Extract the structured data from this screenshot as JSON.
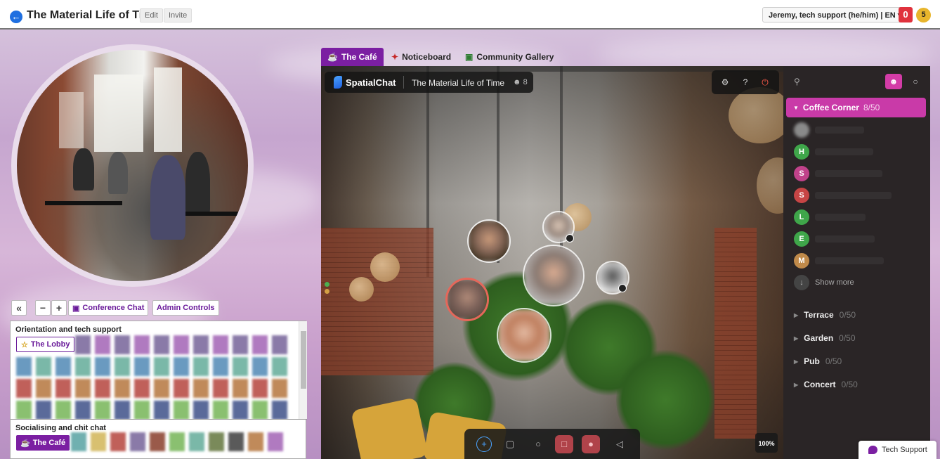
{
  "header": {
    "title": "The Material Life of Time",
    "edit_label": "Edit",
    "invite_label": "Invite",
    "user_menu": "Jeremy, tech support (he/him) | EN",
    "notifications_count": "0",
    "points_count": "5"
  },
  "left": {
    "controls": {
      "collapse_label": "«",
      "zoom_out_label": "−",
      "zoom_in_label": "+",
      "conference_chat_label": "Conference Chat",
      "admin_controls_label": "Admin Controls"
    },
    "rooms": [
      {
        "heading": "Orientation and tech support",
        "room_label": "The Lobby"
      },
      {
        "heading": "Socialising and chit chat",
        "room_label": "The Café"
      }
    ]
  },
  "tabs": [
    {
      "label": "The Café",
      "icon": "mug-icon"
    },
    {
      "label": "Noticeboard",
      "icon": "pin-icon"
    },
    {
      "label": "Community Gallery",
      "icon": "picture-icon"
    }
  ],
  "spatialchat": {
    "brand": "SpatialChat",
    "space_name": "The Material Life of Time",
    "user_count": "8",
    "zoom_level": "100%"
  },
  "sidebar": {
    "active_room": {
      "name": "Coffee Corner",
      "capacity": "8/50"
    },
    "users": [
      {
        "initial": "",
        "color": "#8a8a8a"
      },
      {
        "initial": "H",
        "color": "#3fa64a"
      },
      {
        "initial": "S",
        "color": "#c0428a"
      },
      {
        "initial": "S",
        "color": "#c74545"
      },
      {
        "initial": "L",
        "color": "#3fa64a"
      },
      {
        "initial": "E",
        "color": "#3fa64a"
      },
      {
        "initial": "M",
        "color": "#c08a4a"
      }
    ],
    "show_more_label": "Show more",
    "other_rooms": [
      {
        "name": "Terrace",
        "capacity": "0/50"
      },
      {
        "name": "Garden",
        "capacity": "0/50"
      },
      {
        "name": "Pub",
        "capacity": "0/50"
      },
      {
        "name": "Concert",
        "capacity": "0/50"
      }
    ]
  },
  "tech_support_label": "Tech Support",
  "colors": {
    "accent_purple": "#7b1fa2",
    "accent_pink": "#c93aa8",
    "alert_red": "#e0323d"
  }
}
